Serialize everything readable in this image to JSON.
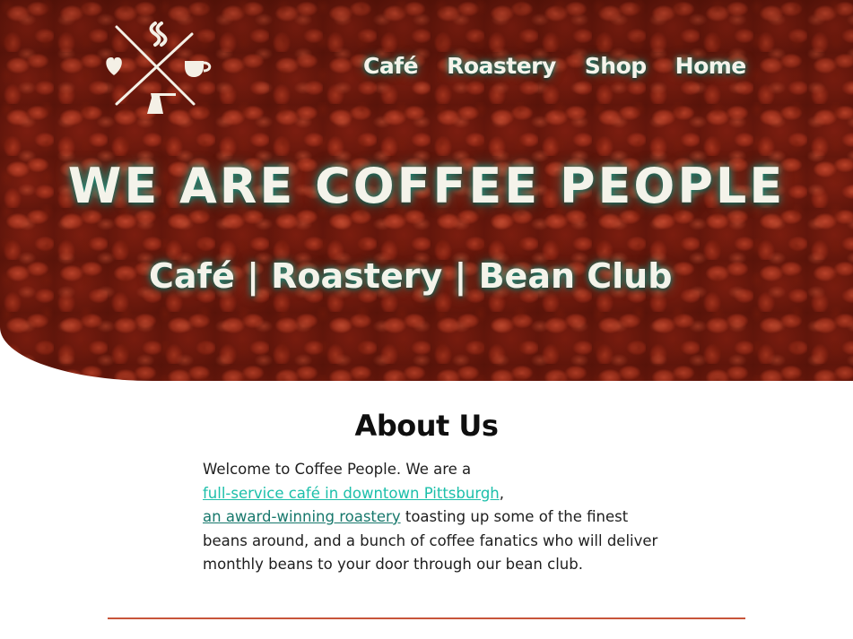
{
  "nav": {
    "items": [
      {
        "label": "Café"
      },
      {
        "label": "Roastery"
      },
      {
        "label": "Shop"
      },
      {
        "label": "Home"
      }
    ]
  },
  "hero": {
    "title": "WE ARE COFFEE PEOPLE",
    "subtitle": "Café | Roastery | Bean Club"
  },
  "about": {
    "heading": "About Us",
    "intro": "Welcome to Coffee People. We are a",
    "link_cafe": "full-service café in downtown Pittsburgh",
    "comma": ",",
    "link_roastery": "an award-winning roastery",
    "rest": " toasting up some of the finest beans around, and a bunch of coffee fanatics who will deliver monthly beans to your door through our bean club."
  },
  "colors": {
    "accent_teal": "#1cbfaa",
    "accent_teal_dark": "#17786c",
    "divider": "#c8553a",
    "hero_bg": "#8a2413"
  },
  "icons": {
    "logo": "coffee-crossed-logo-icon"
  }
}
